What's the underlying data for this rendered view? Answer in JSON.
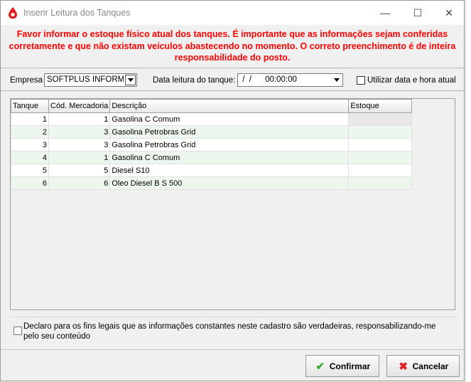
{
  "window": {
    "title": "Inserir Leitura dos Tanques",
    "controls": {
      "minimize": "—",
      "maximize": "☐",
      "close": "✕"
    }
  },
  "warning": "Favor informar o estoque físico atual dos tanques. É importante que as informações sejam conferidas corretamente e que não existam veículos abastecendo no momento. O correto preenchimento é de inteira responsabilidade do posto.",
  "filters": {
    "empresa_label": "Empresa",
    "empresa_value": "SOFTPLUS INFORMÁT",
    "data_label": "Data leitura do tanque:",
    "data_value": " /  /      00:00:00",
    "current_datetime_label": "Utilizar data e hora atual",
    "current_datetime_checked": false
  },
  "grid": {
    "columns": [
      "Tanque",
      "Cód. Mercadoria",
      "Descrição",
      "Estoque"
    ],
    "rows": [
      {
        "tanque": "1",
        "codigo": "1",
        "descricao": "Gasolina C Comum",
        "estoque": ""
      },
      {
        "tanque": "2",
        "codigo": "3",
        "descricao": "Gasolina Petrobras Grid",
        "estoque": ""
      },
      {
        "tanque": "3",
        "codigo": "3",
        "descricao": "Gasolina Petrobras Grid",
        "estoque": ""
      },
      {
        "tanque": "4",
        "codigo": "1",
        "descricao": "Gasolina C Comum",
        "estoque": ""
      },
      {
        "tanque": "5",
        "codigo": "5",
        "descricao": "Diesel S10",
        "estoque": ""
      },
      {
        "tanque": "6",
        "codigo": "6",
        "descricao": "Oleo Diesel B S 500",
        "estoque": ""
      }
    ]
  },
  "declaration": {
    "text": "Declaro para os fins legais que as informações constantes neste cadastro são verdadeiras, responsabilizando-me pelo seu conteúdo",
    "checked": false
  },
  "buttons": {
    "confirm": "Confirmar",
    "cancel": "Cancelar"
  },
  "icons": {
    "app": "drop-icon",
    "confirm": "check-icon",
    "cancel": "x-icon"
  },
  "colors": {
    "warning": "#ff0000",
    "row_alt": "#eef7ee",
    "confirm_icon": "#3aa63a",
    "cancel_icon": "#e02020",
    "app_icon": "#e02020"
  }
}
